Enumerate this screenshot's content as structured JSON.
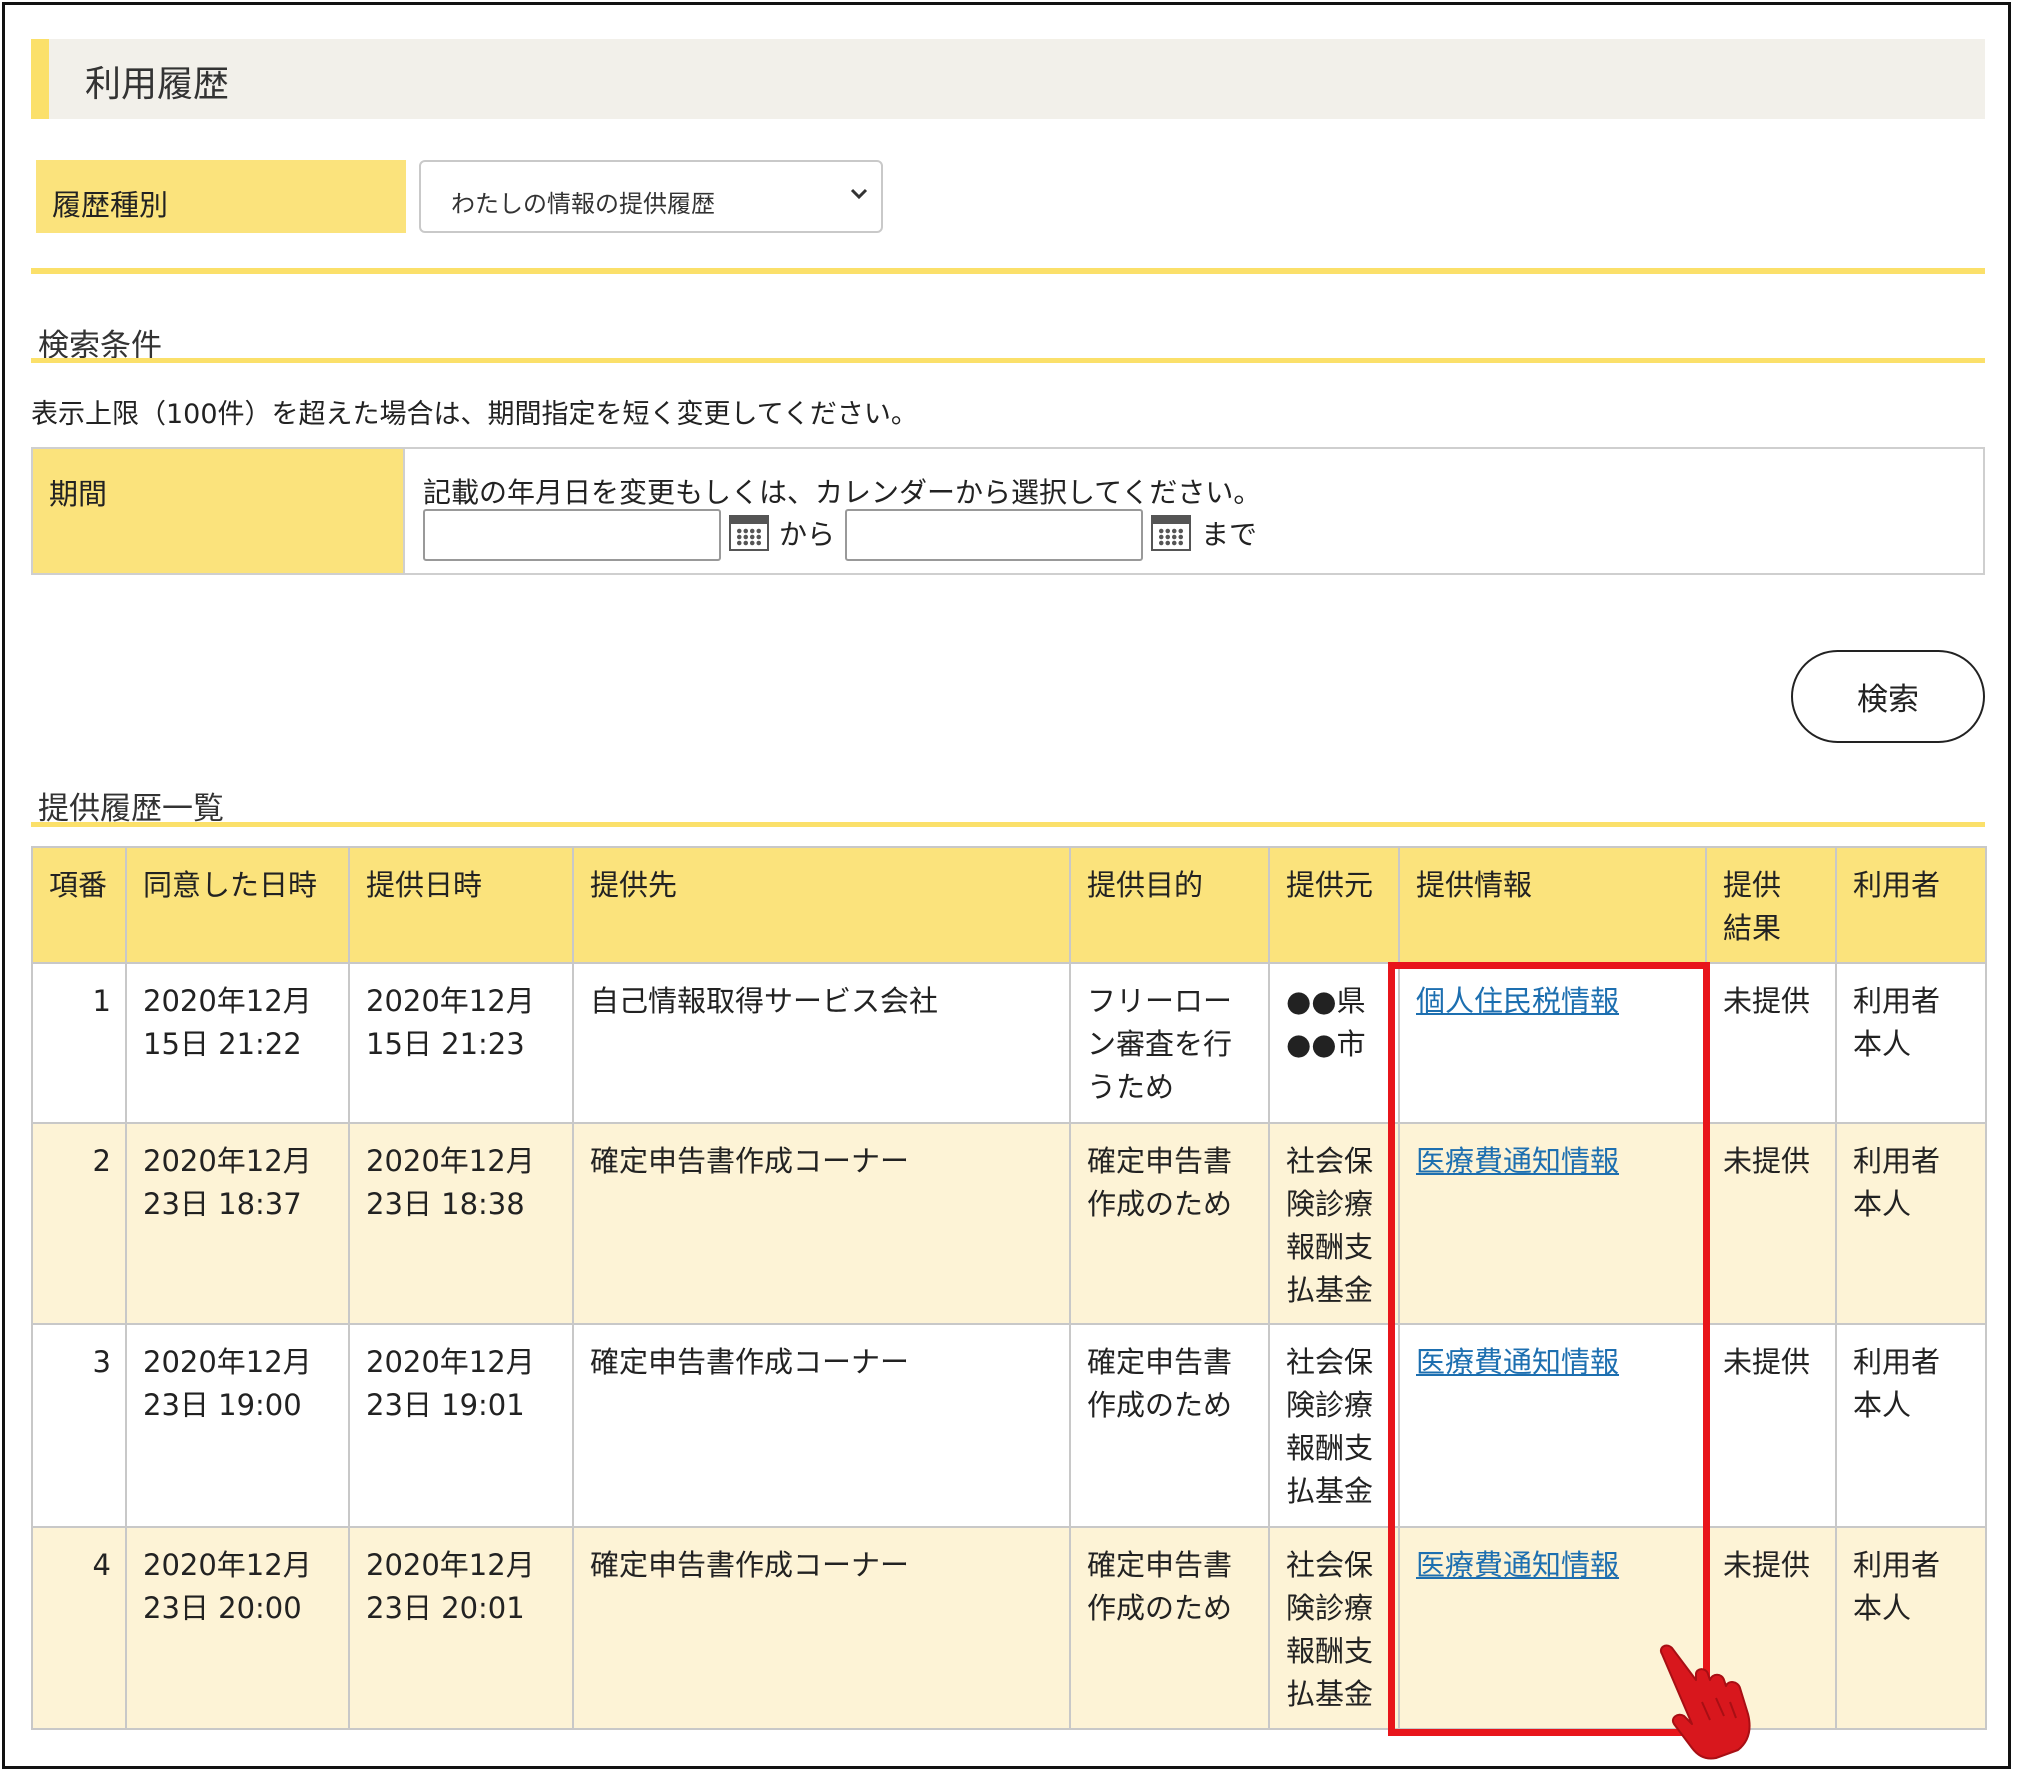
{
  "page": {
    "title": "利用履歴"
  },
  "history_type": {
    "label": "履歴種別",
    "selected": "わたしの情報の提供履歴"
  },
  "search_conditions": {
    "title": "検索条件",
    "note": "表示上限（100件）を超えた場合は、期間指定を短く変更してください。",
    "period": {
      "label": "期間",
      "instruction": "記載の年月日を変更もしくは、カレンダーから選択してください。",
      "from_value": "",
      "to_value": "",
      "from_word": "から",
      "to_word": "まで"
    },
    "search_button": "検索"
  },
  "list": {
    "title": "提供履歴一覧",
    "headers": [
      "項番",
      "同意した日時",
      "提供日時",
      "提供先",
      "提供目的",
      "提供元",
      "提供情報",
      "提供\n結果",
      "利用者"
    ],
    "rows": [
      {
        "no": "1",
        "consent_datetime": "2020年12月\n15日 21:22",
        "provide_datetime": "2020年12月\n15日 21:23",
        "recipient": "自己情報取得サービス会社",
        "purpose": "フリーロー\nン審査を行\nうため",
        "source": "●●県\n●●市",
        "info": "個人住民税情報",
        "result": "未提供",
        "user": "利用者\n本人"
      },
      {
        "no": "2",
        "consent_datetime": "2020年12月\n23日 18:37",
        "provide_datetime": "2020年12月\n23日 18:38",
        "recipient": "確定申告書作成コーナー",
        "purpose": "確定申告書\n作成のため",
        "source": "社会保\n険診療\n報酬支\n払基金",
        "info": "医療費通知情報",
        "result": "未提供",
        "user": "利用者\n本人"
      },
      {
        "no": "3",
        "consent_datetime": "2020年12月\n23日 19:00",
        "provide_datetime": "2020年12月\n23日 19:01",
        "recipient": "確定申告書作成コーナー",
        "purpose": "確定申告書\n作成のため",
        "source": "社会保\n険診療\n報酬支\n払基金",
        "info": "医療費通知情報",
        "result": "未提供",
        "user": "利用者\n本人"
      },
      {
        "no": "4",
        "consent_datetime": "2020年12月\n23日 20:00",
        "provide_datetime": "2020年12月\n23日 20:01",
        "recipient": "確定申告書作成コーナー",
        "purpose": "確定申告書\n作成のため",
        "source": "社会保\n険診療\n報酬支\n払基金",
        "info": "医療費通知情報",
        "result": "未提供",
        "user": "利用者\n本人"
      }
    ]
  },
  "annotation": {
    "highlight_color": "#e8151b",
    "pointer_icon": "hand-pointer-icon"
  },
  "colors": {
    "accent_yellow": "#fbe37c",
    "row_alt": "#fdf3d6",
    "link": "#1d6fb0"
  }
}
